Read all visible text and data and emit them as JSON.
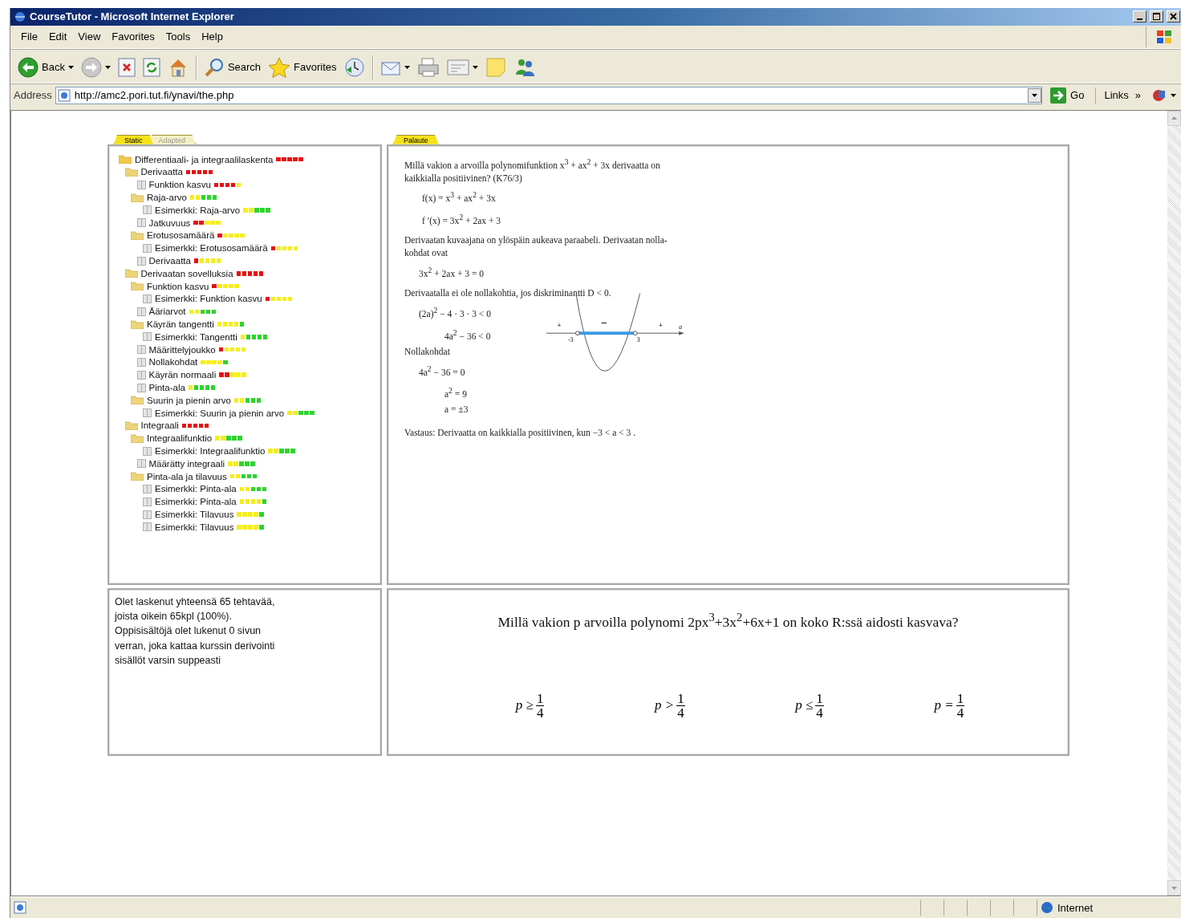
{
  "window": {
    "title": "CourseTutor - Microsoft Internet Explorer"
  },
  "menu": [
    "File",
    "Edit",
    "View",
    "Favorites",
    "Tools",
    "Help"
  ],
  "toolbar": [
    {
      "kind": "back",
      "label": "Back"
    },
    {
      "kind": "forward"
    },
    {
      "kind": "stop"
    },
    {
      "kind": "refresh"
    },
    {
      "kind": "home"
    },
    {
      "kind": "separator"
    },
    {
      "kind": "search",
      "label": "Search"
    },
    {
      "kind": "favorites",
      "label": "Favorites"
    },
    {
      "kind": "history"
    },
    {
      "kind": "separator"
    },
    {
      "kind": "mail"
    },
    {
      "kind": "print"
    },
    {
      "kind": "edit"
    },
    {
      "kind": "note"
    },
    {
      "kind": "messenger"
    }
  ],
  "address_bar": {
    "label": "Address",
    "url": "http://amc2.pori.tut.fi/ynavi/the.php",
    "go": "Go",
    "links": "Links",
    "more": "»"
  },
  "nav_tabs": [
    {
      "label": "Static",
      "selected": true
    },
    {
      "label": "Adapted",
      "selected": false
    }
  ],
  "tree": [
    {
      "kind": "folder",
      "label": "Differentiaali- ja integraalilaskenta",
      "marks": [
        {
          "color": "#e61010"
        },
        {
          "color": "#e61010"
        },
        {
          "color": "#e61010"
        },
        {
          "color": "#e61010"
        },
        {
          "color": "#e61010"
        }
      ],
      "children": [
        {
          "kind": "folder",
          "label": "Derivaatta",
          "marks": [
            {
              "color": "#e61010"
            },
            {
              "color": "#e61010"
            },
            {
              "color": "#e61010"
            },
            {
              "color": "#e61010"
            },
            {
              "color": "#e61010"
            }
          ],
          "children": [
            {
              "kind": "page",
              "label": "Funktion kasvu",
              "marks": [
                {
                  "color": "#e61010"
                },
                {
                  "color": "#e61010"
                },
                {
                  "color": "#e61010"
                },
                {
                  "color": "#e61010"
                },
                {
                  "color": "#f5ee1c"
                }
              ]
            },
            {
              "kind": "folder",
              "label": "Raja-arvo",
              "marks": [
                {
                  "color": "#f5ee1c"
                },
                {
                  "color": "#f5ee1c"
                },
                {
                  "color": "#2ed42e"
                },
                {
                  "color": "#2ed42e"
                },
                {
                  "color": "#2ed42e"
                }
              ],
              "children": [
                {
                  "kind": "page",
                  "label": "Esimerkki: Raja-arvo",
                  "marks": [
                    {
                      "color": "#f5ee1c"
                    },
                    {
                      "color": "#f5ee1c"
                    },
                    {
                      "color": "#2ed42e"
                    },
                    {
                      "color": "#2ed42e"
                    },
                    {
                      "color": "#2ed42e"
                    }
                  ]
                }
              ]
            },
            {
              "kind": "page",
              "label": "Jatkuvuus",
              "marks": [
                {
                  "color": "#e61010"
                },
                {
                  "color": "#e61010"
                },
                {
                  "color": "#f5ee1c"
                },
                {
                  "color": "#f5ee1c"
                },
                {
                  "color": "#f5ee1c"
                }
              ]
            },
            {
              "kind": "folder",
              "label": "Erotusosamäärä",
              "marks": [
                {
                  "color": "#e61010"
                },
                {
                  "color": "#f5ee1c"
                },
                {
                  "color": "#f5ee1c"
                },
                {
                  "color": "#f5ee1c"
                },
                {
                  "color": "#f5ee1c"
                }
              ],
              "children": [
                {
                  "kind": "page",
                  "label": "Esimerkki: Erotusosamäärä",
                  "marks": [
                    {
                      "color": "#e61010"
                    },
                    {
                      "color": "#f5ee1c"
                    },
                    {
                      "color": "#f5ee1c"
                    },
                    {
                      "color": "#f5ee1c"
                    },
                    {
                      "color": "#f5ee1c"
                    }
                  ]
                }
              ]
            },
            {
              "kind": "page",
              "label": "Derivaatta",
              "marks": [
                {
                  "color": "#e61010"
                },
                {
                  "color": "#f5ee1c"
                },
                {
                  "color": "#f5ee1c"
                },
                {
                  "color": "#f5ee1c"
                },
                {
                  "color": "#f5ee1c"
                }
              ]
            }
          ]
        },
        {
          "kind": "folder",
          "label": "Derivaatan sovelluksia",
          "marks": [
            {
              "color": "#e61010"
            },
            {
              "color": "#e61010"
            },
            {
              "color": "#e61010"
            },
            {
              "color": "#e61010"
            },
            {
              "color": "#e61010"
            }
          ],
          "children": [
            {
              "kind": "folder",
              "label": "Funktion kasvu",
              "marks": [
                {
                  "color": "#e61010"
                },
                {
                  "color": "#f5ee1c"
                },
                {
                  "color": "#f5ee1c"
                },
                {
                  "color": "#f5ee1c"
                },
                {
                  "color": "#f5ee1c"
                }
              ],
              "children": [
                {
                  "kind": "page",
                  "label": "Esimerkki: Funktion kasvu",
                  "marks": [
                    {
                      "color": "#e61010"
                    },
                    {
                      "color": "#f5ee1c"
                    },
                    {
                      "color": "#f5ee1c"
                    },
                    {
                      "color": "#f5ee1c"
                    },
                    {
                      "color": "#f5ee1c"
                    }
                  ]
                }
              ]
            },
            {
              "kind": "page",
              "label": "Ääriarvot",
              "marks": [
                {
                  "color": "#f5ee1c"
                },
                {
                  "color": "#f5ee1c"
                },
                {
                  "color": "#2ed42e"
                },
                {
                  "color": "#2ed42e"
                },
                {
                  "color": "#2ed42e"
                }
              ]
            },
            {
              "kind": "folder",
              "label": "Käyrän tangentti",
              "marks": [
                {
                  "color": "#f5ee1c"
                },
                {
                  "color": "#f5ee1c"
                },
                {
                  "color": "#f5ee1c"
                },
                {
                  "color": "#f5ee1c"
                },
                {
                  "color": "#2ed42e"
                }
              ],
              "children": [
                {
                  "kind": "page",
                  "label": "Esimerkki: Tangentti",
                  "marks": [
                    {
                      "color": "#f5ee1c"
                    },
                    {
                      "color": "#2ed42e"
                    },
                    {
                      "color": "#2ed42e"
                    },
                    {
                      "color": "#2ed42e"
                    },
                    {
                      "color": "#2ed42e"
                    }
                  ]
                }
              ]
            },
            {
              "kind": "page",
              "label": "Määrittelyjoukko",
              "marks": [
                {
                  "color": "#e61010"
                },
                {
                  "color": "#f5ee1c"
                },
                {
                  "color": "#f5ee1c"
                },
                {
                  "color": "#f5ee1c"
                },
                {
                  "color": "#f5ee1c"
                }
              ]
            },
            {
              "kind": "page",
              "label": "Nollakohdat",
              "marks": [
                {
                  "color": "#f5ee1c"
                },
                {
                  "color": "#f5ee1c"
                },
                {
                  "color": "#f5ee1c"
                },
                {
                  "color": "#f5ee1c"
                },
                {
                  "color": "#2ed42e"
                }
              ]
            },
            {
              "kind": "page",
              "label": "Käyrän normaali",
              "marks": [
                {
                  "color": "#e61010"
                },
                {
                  "color": "#e61010"
                },
                {
                  "color": "#f5ee1c"
                },
                {
                  "color": "#f5ee1c"
                },
                {
                  "color": "#f5ee1c"
                }
              ]
            },
            {
              "kind": "page",
              "label": "Pinta-ala",
              "marks": [
                {
                  "color": "#f5ee1c"
                },
                {
                  "color": "#2ed42e"
                },
                {
                  "color": "#2ed42e"
                },
                {
                  "color": "#2ed42e"
                },
                {
                  "color": "#2ed42e"
                }
              ]
            },
            {
              "kind": "folder",
              "label": "Suurin ja pienin arvo",
              "marks": [
                {
                  "color": "#f5ee1c"
                },
                {
                  "color": "#f5ee1c"
                },
                {
                  "color": "#2ed42e"
                },
                {
                  "color": "#2ed42e"
                },
                {
                  "color": "#2ed42e"
                }
              ],
              "children": [
                {
                  "kind": "page",
                  "label": "Esimerkki: Suurin ja pienin arvo",
                  "marks": [
                    {
                      "color": "#f5ee1c"
                    },
                    {
                      "color": "#f5ee1c"
                    },
                    {
                      "color": "#2ed42e"
                    },
                    {
                      "color": "#2ed42e"
                    },
                    {
                      "color": "#2ed42e"
                    }
                  ]
                }
              ]
            }
          ]
        },
        {
          "kind": "folder",
          "label": "Integraali",
          "marks": [
            {
              "color": "#e61010"
            },
            {
              "color": "#e61010"
            },
            {
              "color": "#e61010"
            },
            {
              "color": "#e61010"
            },
            {
              "color": "#e61010"
            }
          ],
          "children": [
            {
              "kind": "folder",
              "label": "Integraalifunktio",
              "marks": [
                {
                  "color": "#f5ee1c"
                },
                {
                  "color": "#f5ee1c"
                },
                {
                  "color": "#2ed42e"
                },
                {
                  "color": "#2ed42e"
                },
                {
                  "color": "#2ed42e"
                }
              ],
              "children": [
                {
                  "kind": "page",
                  "label": "Esimerkki: Integraalifunktio",
                  "marks": [
                    {
                      "color": "#f5ee1c"
                    },
                    {
                      "color": "#f5ee1c"
                    },
                    {
                      "color": "#2ed42e"
                    },
                    {
                      "color": "#2ed42e"
                    },
                    {
                      "color": "#2ed42e"
                    }
                  ]
                }
              ]
            },
            {
              "kind": "page",
              "label": "Määrätty integraali",
              "marks": [
                {
                  "color": "#f5ee1c"
                },
                {
                  "color": "#f5ee1c"
                },
                {
                  "color": "#2ed42e"
                },
                {
                  "color": "#2ed42e"
                },
                {
                  "color": "#2ed42e"
                }
              ]
            },
            {
              "kind": "folder",
              "label": "Pinta-ala ja tilavuus",
              "marks": [
                {
                  "color": "#f5ee1c"
                },
                {
                  "color": "#f5ee1c"
                },
                {
                  "color": "#2ed42e"
                },
                {
                  "color": "#2ed42e"
                },
                {
                  "color": "#2ed42e"
                }
              ],
              "children": [
                {
                  "kind": "page",
                  "label": "Esimerkki: Pinta-ala",
                  "marks": [
                    {
                      "color": "#f5ee1c"
                    },
                    {
                      "color": "#f5ee1c"
                    },
                    {
                      "color": "#2ed42e"
                    },
                    {
                      "color": "#2ed42e"
                    },
                    {
                      "color": "#2ed42e"
                    }
                  ]
                },
                {
                  "kind": "page",
                  "label": "Esimerkki: Pinta-ala",
                  "marks": [
                    {
                      "color": "#f5ee1c"
                    },
                    {
                      "color": "#f5ee1c"
                    },
                    {
                      "color": "#f5ee1c"
                    },
                    {
                      "color": "#f5ee1c"
                    },
                    {
                      "color": "#2ed42e"
                    }
                  ]
                },
                {
                  "kind": "page",
                  "label": "Esimerkki: Tilavuus",
                  "marks": [
                    {
                      "color": "#f5ee1c"
                    },
                    {
                      "color": "#f5ee1c"
                    },
                    {
                      "color": "#f5ee1c"
                    },
                    {
                      "color": "#f5ee1c"
                    },
                    {
                      "color": "#2ed42e"
                    }
                  ]
                },
                {
                  "kind": "page",
                  "label": "Esimerkki: Tilavuus",
                  "marks": [
                    {
                      "color": "#f5ee1c"
                    },
                    {
                      "color": "#f5ee1c"
                    },
                    {
                      "color": "#f5ee1c"
                    },
                    {
                      "color": "#f5ee1c"
                    },
                    {
                      "color": "#2ed42e"
                    }
                  ]
                }
              ]
            }
          ]
        }
      ]
    }
  ],
  "content_tabs": [
    {
      "label": "Palaute",
      "selected": true
    }
  ],
  "solution": {
    "top": [
      {
        "kind": "text",
        "text": "Millä vakion a arvoilla polynomifunktion  x$^{3}$ + ax$^{2}$ + 3x derivaatta on kaikkialla positiivinen? (K76/3)"
      },
      {
        "kind": "display",
        "text": "f(x) = x$^{3}$ + ax$^{2}$ + 3x"
      },
      {
        "kind": "display",
        "text": "f ′(x) = 3x$^{2}$ + 2ax + 3"
      },
      {
        "kind": "text",
        "text": "Derivaatan kuvaajana on ylöspäin aukeava paraabeli. Derivaatan nolla-kohdat ovat"
      },
      {
        "kind": "equation",
        "text": "3x$^{2}$ + 2ax + 3 = 0"
      },
      {
        "kind": "text",
        "text": "Derivaatalla ei ole nollakohtia, jos diskriminantti D < 0."
      }
    ],
    "left": [
      {
        "kind": "equation",
        "text": "(2a)$^{2}$ − 4 · 3 · 3 < 0"
      },
      {
        "kind": "equation-deep",
        "text": "4a$^{2}$ − 36 < 0"
      },
      {
        "kind": "text",
        "text": "Nollakohdat"
      },
      {
        "kind": "equation",
        "text": "4a$^{2}$ − 36 = 0"
      },
      {
        "kind": "equation-deep",
        "text": "a$^{2}$ = 9"
      },
      {
        "kind": "equation-deep",
        "text": "a = ±3"
      }
    ],
    "graph": {
      "plus_left": "+",
      "minus": "−",
      "plus_right": "+",
      "axis": "a",
      "left_zero": "-3",
      "right_zero": "3"
    },
    "answer": "Vastaus: Derivaatta on kaikkialla positiivinen, kun  −3 < a < 3 ."
  },
  "summary": [
    "Olet laskenut yhteensä 65 tehtavää,",
    "joista oikein 65kpl (100%).",
    "Oppisisältöjä olet lukenut 0 sivun",
    "verran, joka kattaa kurssin derivointi",
    "sisällöt varsin suppeasti"
  ],
  "question": {
    "text": "Millä vakion p arvoilla polynomi  2px$^{3}$+3x$^{2}$+6x+1  on koko R:ssä aidosti kasvava?",
    "options": [
      {
        "relation": "p ≥",
        "numerator": "1",
        "denominator": "4"
      },
      {
        "relation": "p >",
        "numerator": "1",
        "denominator": "4"
      },
      {
        "relation": "p ≤",
        "numerator": "1",
        "denominator": "4"
      },
      {
        "relation": "p =",
        "numerator": "1",
        "denominator": "4"
      }
    ]
  },
  "status_bar": {
    "zone": "Internet"
  }
}
